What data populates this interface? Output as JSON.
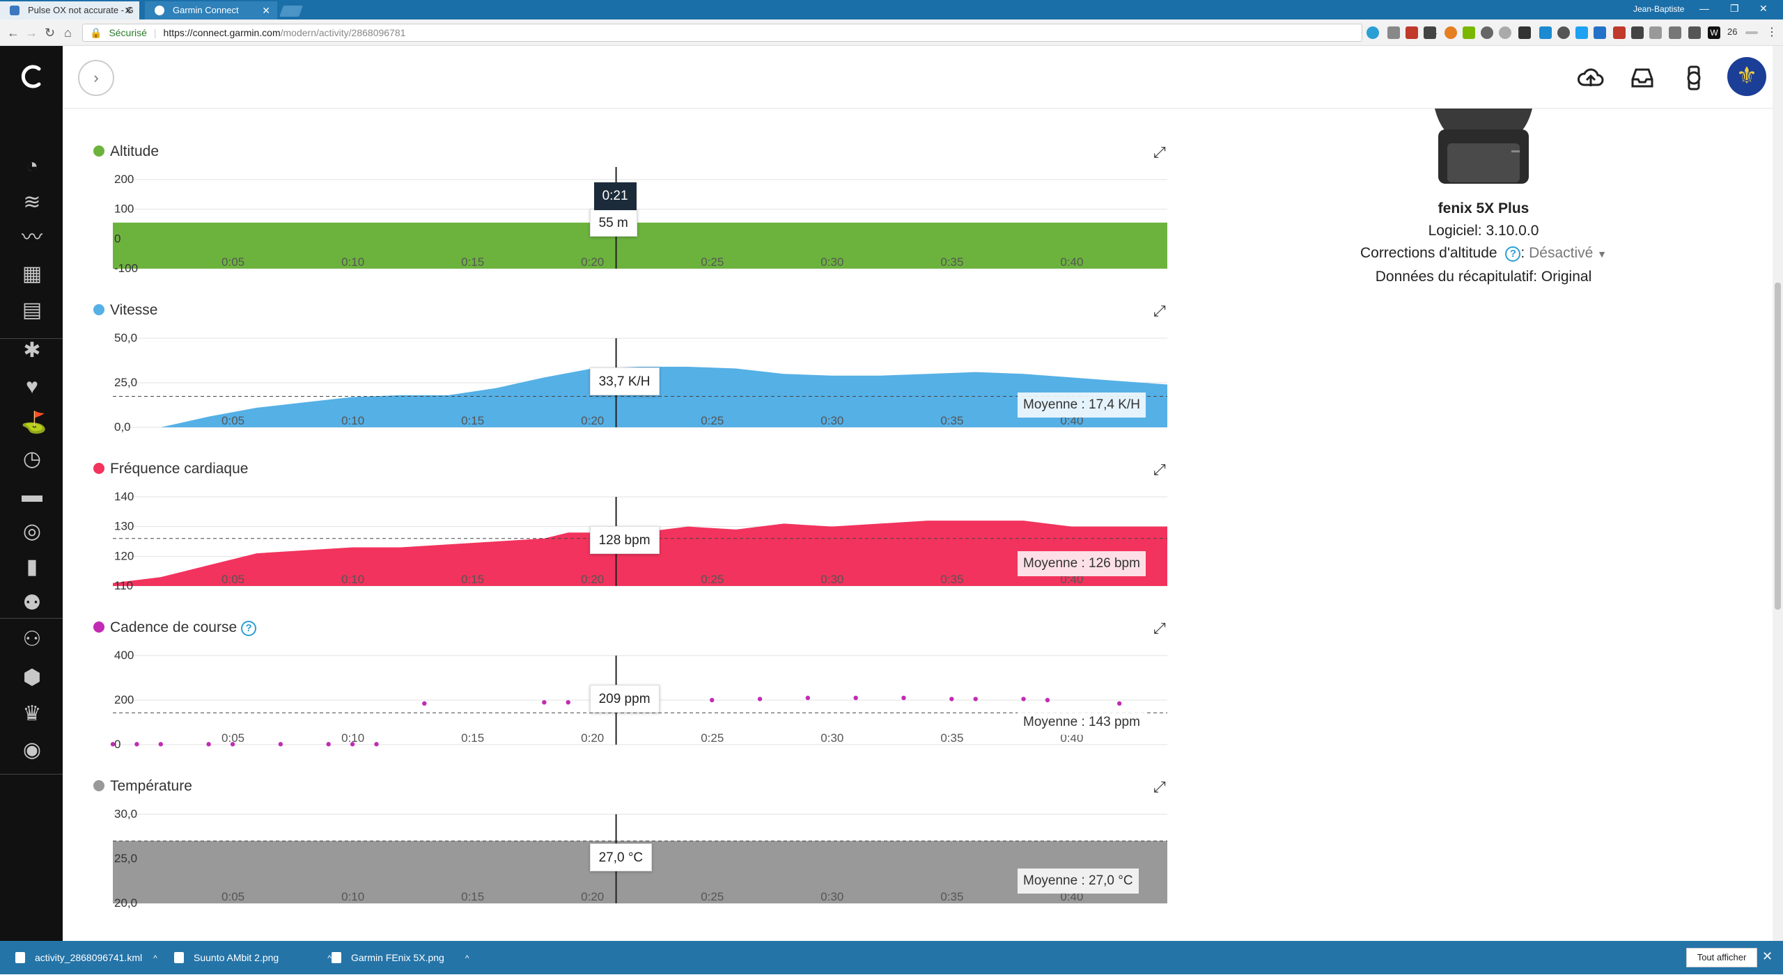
{
  "browser": {
    "tabs": [
      {
        "title": "Pulse OX not accurate - G",
        "active": false
      },
      {
        "title": "Garmin Connect",
        "active": true
      }
    ],
    "user": "Jean-Baptiste",
    "secure_label": "Sécurisé",
    "url_host": "https://connect.garmin.com",
    "url_path": "/modern/activity/2868096781",
    "badge_count": "26"
  },
  "sidebar": {
    "icons": [
      "dashboard-icon",
      "layers-icon",
      "trend-icon",
      "calendar-icon",
      "newsfeed-icon",
      "activity-person-icon",
      "heart-icon",
      "golf-icon",
      "stopwatch-icon",
      "shoe-icon",
      "lightbulb-icon",
      "bar-chart-icon",
      "group-icon",
      "connections-icon",
      "badge-icon",
      "trophy-icon",
      "target-icon"
    ]
  },
  "device": {
    "name": "fenix 5X Plus",
    "software": "Logiciel: 3.10.0.0",
    "altitude_label": "Corrections d'altitude",
    "altitude_help": "?",
    "altitude_sep": ":",
    "altitude_value": "Désactivé",
    "summary": "Données du récapitulatif: Original"
  },
  "charts_common": {
    "x_ticks": [
      "0:05",
      "0:10",
      "0:15",
      "0:20",
      "0:25",
      "0:30",
      "0:35",
      "0:40"
    ],
    "cursor_time": "0:21"
  },
  "chart_data": [
    {
      "type": "area",
      "title": "Altitude",
      "color": "#6cb33e",
      "y_ticks": [
        "200",
        "100",
        "0",
        "-100"
      ],
      "ylim": [
        -100,
        200
      ],
      "x": [
        0,
        44
      ],
      "values": [
        55,
        55
      ],
      "tooltip": "55 m"
    },
    {
      "type": "area",
      "title": "Vitesse",
      "color": "#55b0e6",
      "y_ticks": [
        "50,0",
        "25,0",
        "0,0"
      ],
      "ylim": [
        0,
        50
      ],
      "x": [
        0,
        2,
        4,
        6,
        8,
        10,
        12,
        14,
        16,
        18,
        20,
        22,
        24,
        26,
        28,
        30,
        32,
        34,
        36,
        38,
        40,
        42,
        44
      ],
      "values": [
        0,
        0,
        6,
        11,
        14,
        17,
        18,
        18,
        22,
        28,
        33,
        34,
        34,
        33,
        30,
        29,
        29,
        30,
        31,
        30,
        28,
        26,
        24
      ],
      "tooltip": "33,7 K/H",
      "average": 17.4,
      "average_label": "Moyenne : 17,4 K/H"
    },
    {
      "type": "area",
      "title": "Fréquence cardiaque",
      "color": "#f2335d",
      "y_ticks": [
        "140",
        "130",
        "120",
        "110"
      ],
      "ylim": [
        110,
        140
      ],
      "x": [
        0,
        2,
        4,
        6,
        8,
        10,
        12,
        14,
        16,
        18,
        19,
        20,
        22,
        24,
        26,
        28,
        30,
        32,
        34,
        36,
        38,
        40,
        42,
        44
      ],
      "values": [
        111,
        113,
        117,
        121,
        122,
        123,
        123,
        124,
        125,
        126,
        128,
        128,
        128,
        130,
        129,
        131,
        130,
        131,
        132,
        132,
        132,
        130,
        130,
        130
      ],
      "tooltip": "128 bpm",
      "average": 126,
      "average_label": "Moyenne : 126 bpm"
    },
    {
      "type": "scatter",
      "title": "Cadence de course",
      "help": "?",
      "color": "#c22bb4",
      "y_ticks": [
        "400",
        "200",
        "0"
      ],
      "ylim": [
        0,
        400
      ],
      "x": [
        0,
        1,
        2,
        4,
        5,
        7,
        9,
        10,
        11,
        13,
        18,
        19,
        21,
        25,
        27,
        29,
        31,
        33,
        35,
        36,
        38,
        39,
        42
      ],
      "values": [
        2,
        2,
        2,
        2,
        2,
        2,
        2,
        2,
        2,
        185,
        190,
        190,
        195,
        200,
        205,
        210,
        210,
        210,
        205,
        205,
        205,
        200,
        185
      ],
      "tooltip": "209 ppm",
      "average": 143,
      "average_label": "Moyenne : 143 ppm"
    },
    {
      "type": "area",
      "title": "Température",
      "color": "#999999",
      "y_ticks": [
        "30,0",
        "25,0",
        "20,0"
      ],
      "ylim": [
        20,
        30
      ],
      "x": [
        0,
        44
      ],
      "values": [
        27,
        27
      ],
      "tooltip": "27,0 °C",
      "average": 27,
      "average_label": "Moyenne : 27,0 °C"
    }
  ],
  "downloads": {
    "files": [
      "activity_2868096741.kml",
      "Suunto AMbit 2.png",
      "Garmin FEnix 5X.png"
    ],
    "show_all": "Tout afficher"
  }
}
